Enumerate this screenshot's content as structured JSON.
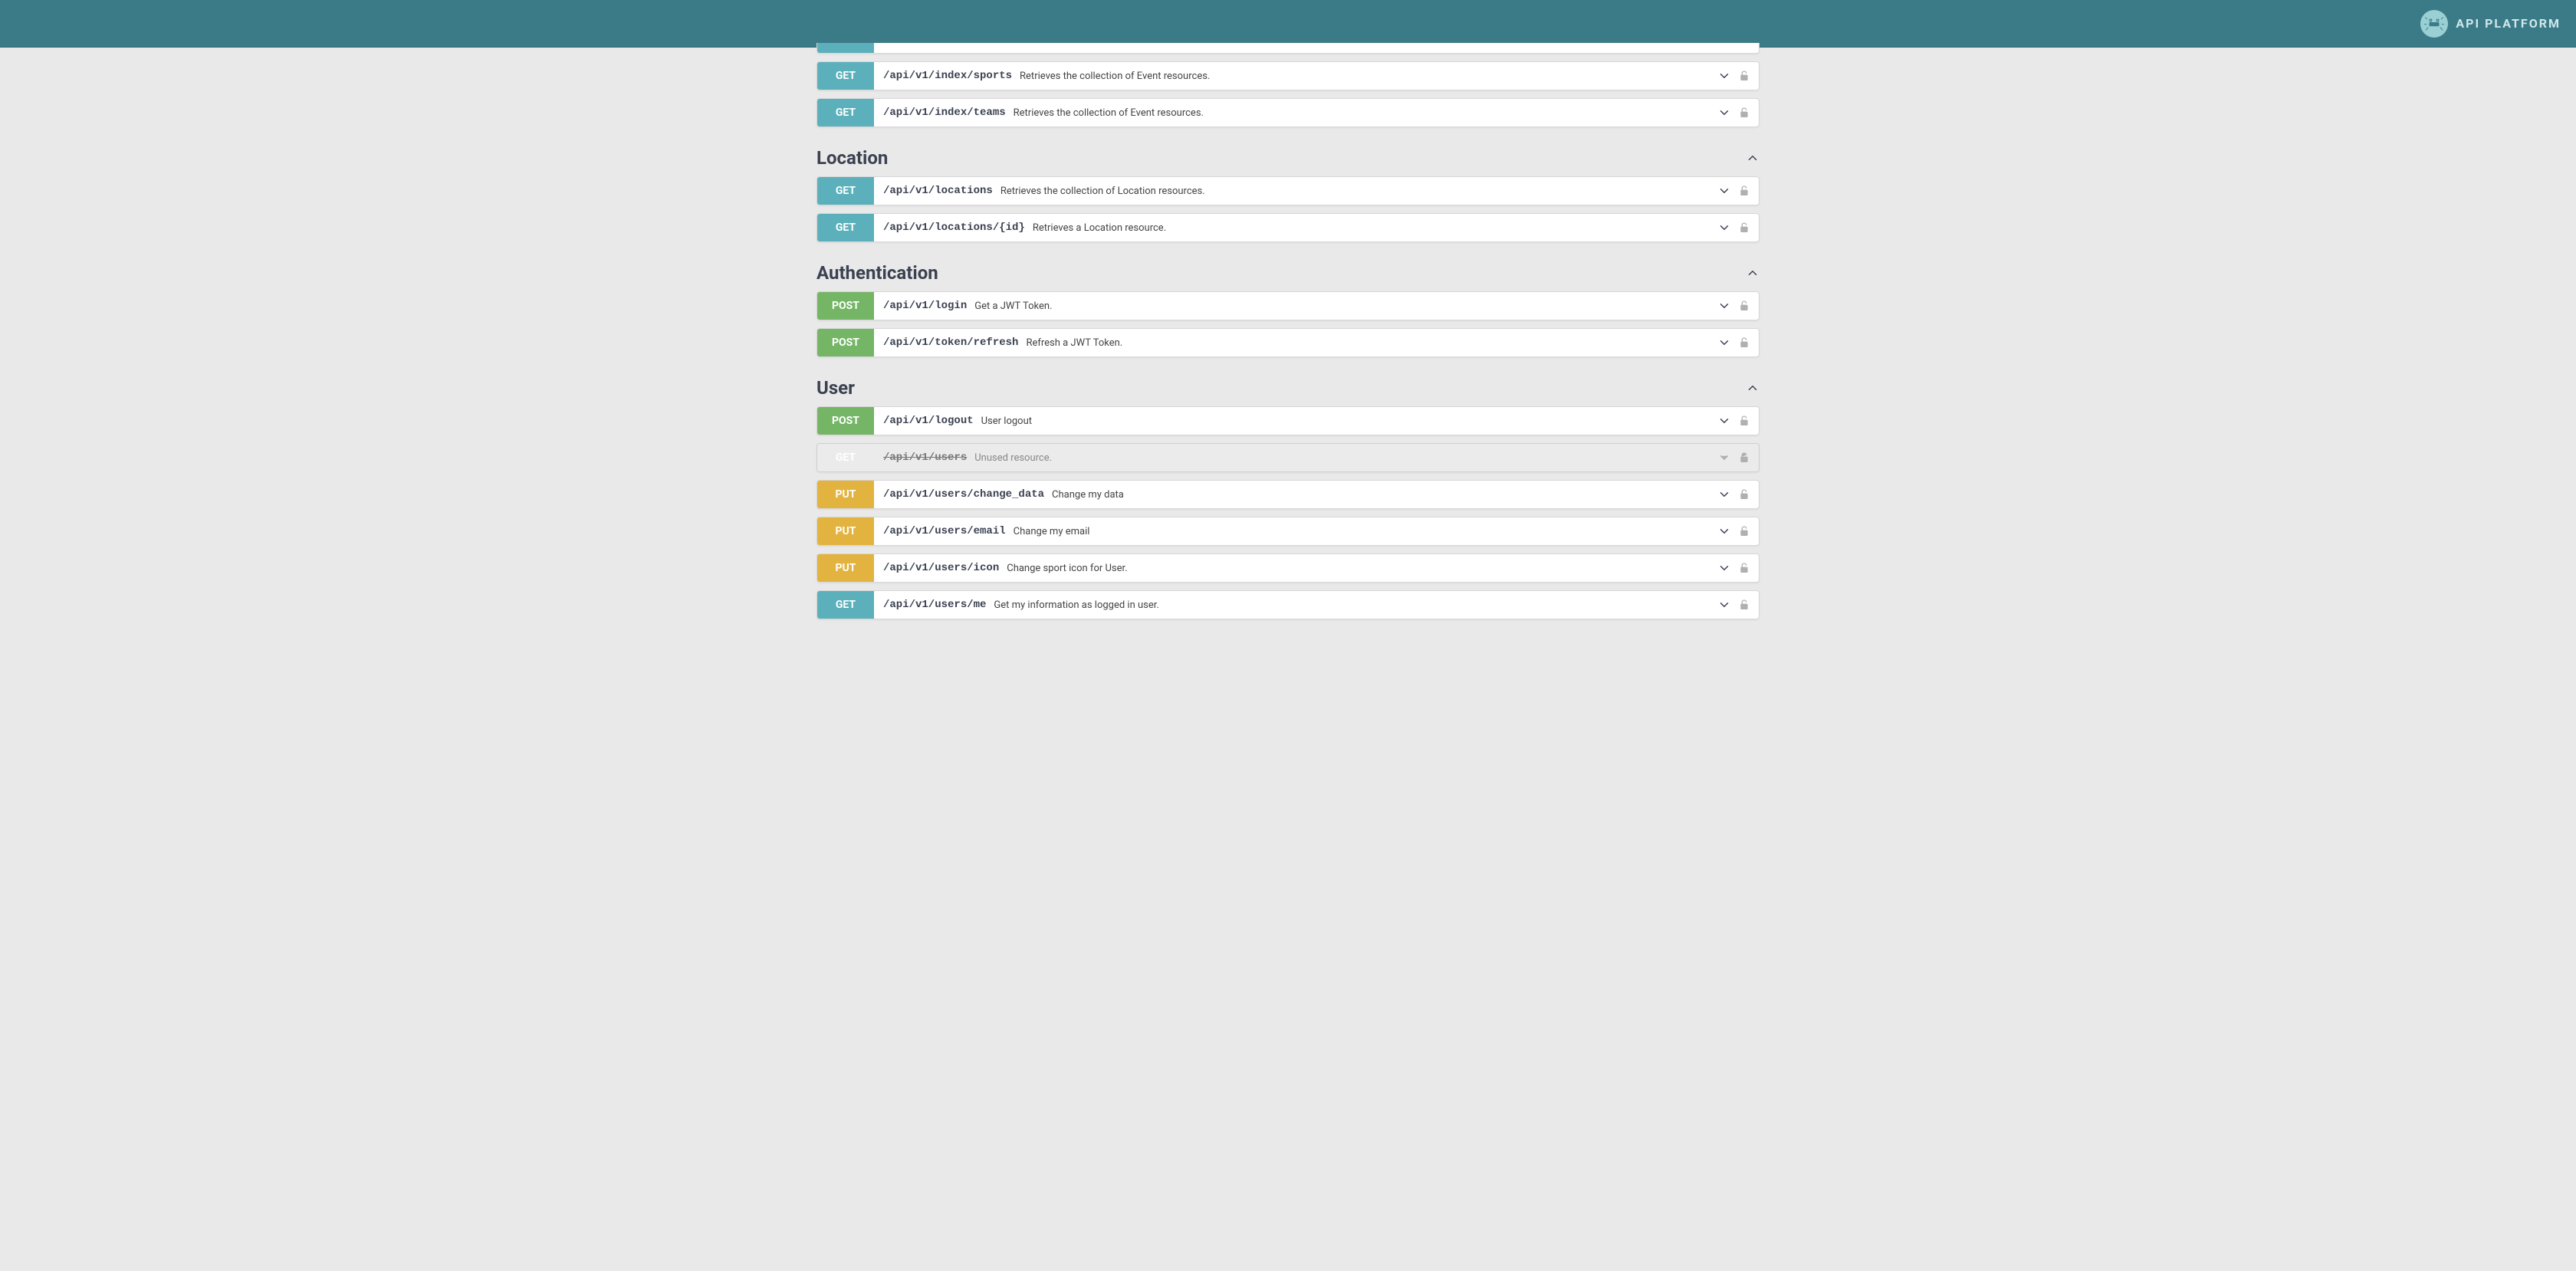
{
  "header": {
    "brand": "API PLATFORM"
  },
  "topOps": [
    {
      "method": "GET",
      "methodClass": "method-get",
      "path": "/api/v1/index/sports",
      "summary": "Retrieves the collection of Event resources.",
      "deprecated": false
    },
    {
      "method": "GET",
      "methodClass": "method-get",
      "path": "/api/v1/index/teams",
      "summary": "Retrieves the collection of Event resources.",
      "deprecated": false
    }
  ],
  "sections": [
    {
      "title": "Location",
      "ops": [
        {
          "method": "GET",
          "methodClass": "method-get",
          "path": "/api/v1/locations",
          "summary": "Retrieves the collection of Location resources.",
          "deprecated": false
        },
        {
          "method": "GET",
          "methodClass": "method-get",
          "path": "/api/v1/locations/{id}",
          "summary": "Retrieves a Location resource.",
          "deprecated": false
        }
      ]
    },
    {
      "title": "Authentication",
      "ops": [
        {
          "method": "POST",
          "methodClass": "method-post",
          "path": "/api/v1/login",
          "summary": "Get a JWT Token.",
          "deprecated": false
        },
        {
          "method": "POST",
          "methodClass": "method-post",
          "path": "/api/v1/token/refresh",
          "summary": "Refresh a JWT Token.",
          "deprecated": false
        }
      ]
    },
    {
      "title": "User",
      "ops": [
        {
          "method": "POST",
          "methodClass": "method-post",
          "path": "/api/v1/logout",
          "summary": "User logout",
          "deprecated": false
        },
        {
          "method": "GET",
          "methodClass": "method-get-dep",
          "path": "/api/v1/users",
          "summary": "Unused resource.",
          "deprecated": true
        },
        {
          "method": "PUT",
          "methodClass": "method-put",
          "path": "/api/v1/users/change_data",
          "summary": "Change my data",
          "deprecated": false
        },
        {
          "method": "PUT",
          "methodClass": "method-put",
          "path": "/api/v1/users/email",
          "summary": "Change my email",
          "deprecated": false
        },
        {
          "method": "PUT",
          "methodClass": "method-put",
          "path": "/api/v1/users/icon",
          "summary": "Change sport icon for User.",
          "deprecated": false
        },
        {
          "method": "GET",
          "methodClass": "method-get",
          "path": "/api/v1/users/me",
          "summary": "Get my information as logged in user.",
          "deprecated": false
        }
      ]
    }
  ]
}
